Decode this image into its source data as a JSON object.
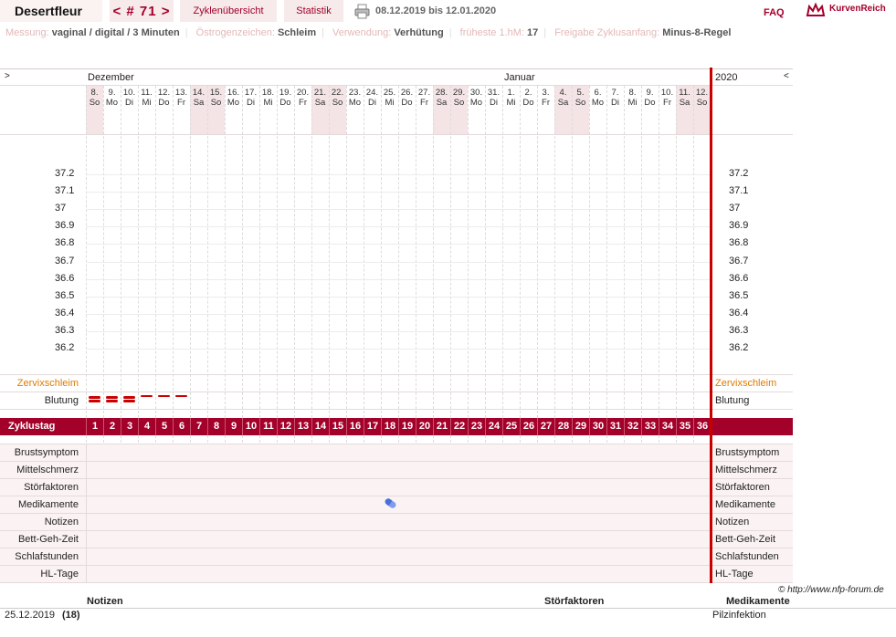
{
  "header": {
    "user": "Desertfleur",
    "cycle": "< # 71 >",
    "tab_overview": "Zyklenübersicht",
    "tab_stats": "Statistik",
    "date_range": "08.12.2019 bis 12.01.2020",
    "faq": "FAQ",
    "brand": "KurvenReich"
  },
  "info": {
    "messung_label": "Messung:",
    "messung_value": "vaginal / digital / 3 Minuten",
    "oestrogen_label": "Östrogenzeichen:",
    "oestrogen_value": "Schleim",
    "verwendung_label": "Verwendung:",
    "verwendung_value": "Verhütung",
    "frueheste_label": "früheste 1.hM:",
    "frueheste_value": "17",
    "freigabe_label": "Freigabe Zyklusanfang:",
    "freigabe_value": "Minus-8-Regel"
  },
  "chart": {
    "nav_left": ">",
    "nav_right": "<",
    "month1": "Dezember",
    "month2": "Januar",
    "year": "2020",
    "days": [
      {
        "d": "8.",
        "w": "So",
        "we": true
      },
      {
        "d": "9.",
        "w": "Mo",
        "we": false
      },
      {
        "d": "10.",
        "w": "Di",
        "we": false
      },
      {
        "d": "11.",
        "w": "Mi",
        "we": false
      },
      {
        "d": "12.",
        "w": "Do",
        "we": false
      },
      {
        "d": "13.",
        "w": "Fr",
        "we": false
      },
      {
        "d": "14.",
        "w": "Sa",
        "we": true
      },
      {
        "d": "15.",
        "w": "So",
        "we": true
      },
      {
        "d": "16.",
        "w": "Mo",
        "we": false
      },
      {
        "d": "17.",
        "w": "Di",
        "we": false
      },
      {
        "d": "18.",
        "w": "Mi",
        "we": false
      },
      {
        "d": "19.",
        "w": "Do",
        "we": false
      },
      {
        "d": "20.",
        "w": "Fr",
        "we": false
      },
      {
        "d": "21.",
        "w": "Sa",
        "we": true
      },
      {
        "d": "22.",
        "w": "So",
        "we": true
      },
      {
        "d": "23.",
        "w": "Mo",
        "we": false
      },
      {
        "d": "24.",
        "w": "Di",
        "we": false
      },
      {
        "d": "25.",
        "w": "Mi",
        "we": false
      },
      {
        "d": "26.",
        "w": "Do",
        "we": false
      },
      {
        "d": "27.",
        "w": "Fr",
        "we": false
      },
      {
        "d": "28.",
        "w": "Sa",
        "we": true
      },
      {
        "d": "29.",
        "w": "So",
        "we": true
      },
      {
        "d": "30.",
        "w": "Mo",
        "we": false
      },
      {
        "d": "31.",
        "w": "Di",
        "we": false
      },
      {
        "d": "1.",
        "w": "Mi",
        "we": false
      },
      {
        "d": "2.",
        "w": "Do",
        "we": false
      },
      {
        "d": "3.",
        "w": "Fr",
        "we": false
      },
      {
        "d": "4.",
        "w": "Sa",
        "we": true
      },
      {
        "d": "5.",
        "w": "So",
        "we": true
      },
      {
        "d": "6.",
        "w": "Mo",
        "we": false
      },
      {
        "d": "7.",
        "w": "Di",
        "we": false
      },
      {
        "d": "8.",
        "w": "Mi",
        "we": false
      },
      {
        "d": "9.",
        "w": "Do",
        "we": false
      },
      {
        "d": "10.",
        "w": "Fr",
        "we": false
      },
      {
        "d": "11.",
        "w": "Sa",
        "we": true
      },
      {
        "d": "12.",
        "w": "So",
        "we": true
      }
    ],
    "temps": [
      "37.2",
      "37.1",
      "37",
      "36.9",
      "36.8",
      "36.7",
      "36.6",
      "36.5",
      "36.4",
      "36.3",
      "36.2"
    ],
    "zervix_label": "Zervixschleim",
    "blutung_label": "Blutung",
    "bleeding": [
      {
        "day": 1,
        "level": "heavy"
      },
      {
        "day": 2,
        "level": "heavy"
      },
      {
        "day": 3,
        "level": "heavy"
      },
      {
        "day": 4,
        "level": "light"
      },
      {
        "day": 5,
        "level": "light"
      },
      {
        "day": 6,
        "level": "light"
      }
    ],
    "zyklustag_label": "Zyklustag",
    "cycle_days": [
      "1",
      "2",
      "3",
      "4",
      "5",
      "6",
      "7",
      "8",
      "9",
      "10",
      "11",
      "12",
      "13",
      "14",
      "15",
      "16",
      "17",
      "18",
      "19",
      "20",
      "21",
      "22",
      "23",
      "24",
      "25",
      "26",
      "27",
      "28",
      "29",
      "30",
      "31",
      "32",
      "33",
      "34",
      "35",
      "36"
    ],
    "rows": [
      "Brustsymptom",
      "Mittelschmerz",
      "Störfaktoren",
      "Medikamente",
      "Notizen",
      "Bett-Geh-Zeit",
      "Schlafstunden",
      "HL-Tage"
    ],
    "medication_day": 18
  },
  "footer": {
    "copyright": "© http://www.nfp-forum.de",
    "col_notizen": "Notizen",
    "col_stoer": "Störfaktoren",
    "col_medi": "Medikamente",
    "entry_date": "25.12.2019",
    "entry_day": "(18)",
    "entry_medi": "Pilzinfektion"
  }
}
